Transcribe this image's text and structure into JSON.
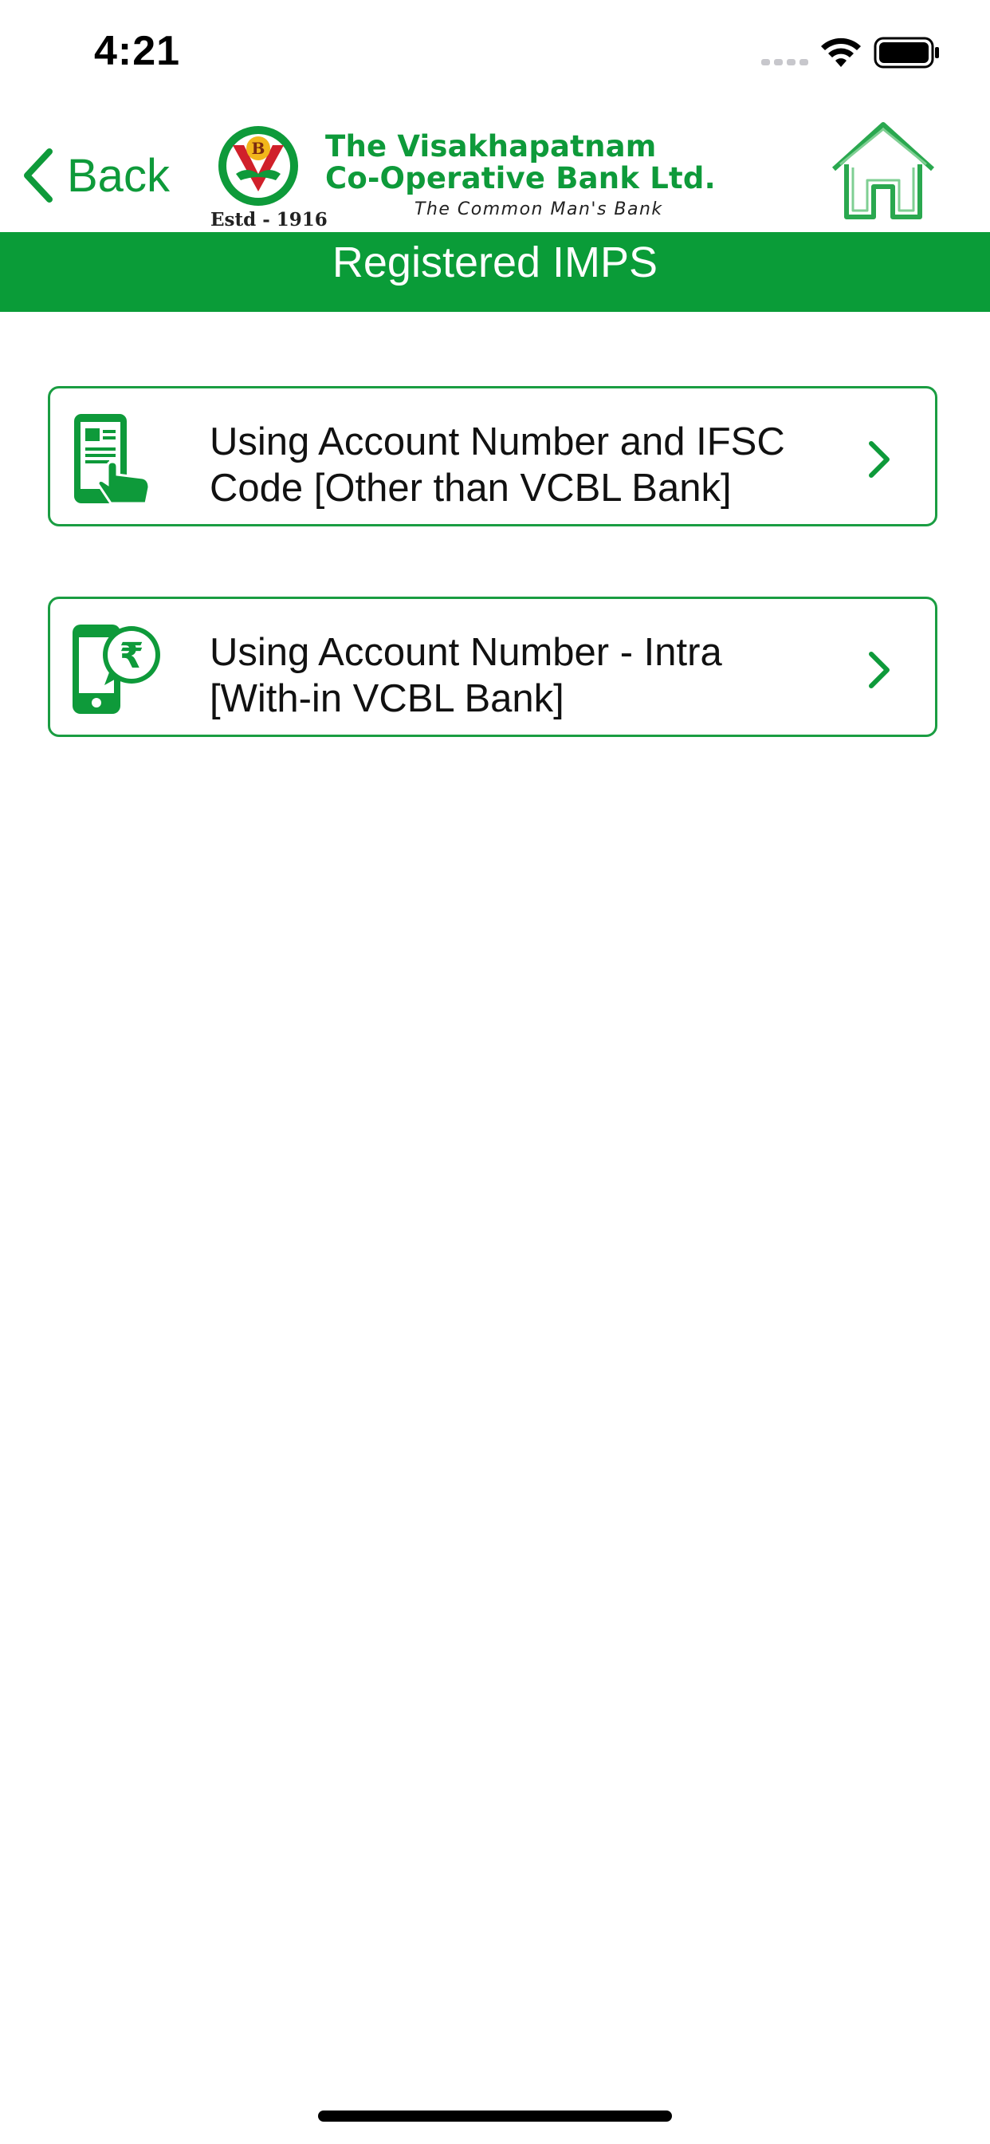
{
  "status_bar": {
    "time": "4:21",
    "signal_icon": "signal-dots-icon",
    "wifi_icon": "wifi-icon",
    "battery_icon": "battery-icon"
  },
  "nav_bar": {
    "back_label": "Back",
    "back_icon": "chevron-left-icon",
    "home_icon": "home-icon",
    "logo": {
      "name_line_1": "The Visakhapatnam",
      "name_line_2": "Co-Operative Bank Ltd.",
      "tagline": "The Common Man's Bank",
      "established": "Estd - 1916"
    }
  },
  "page": {
    "title": "Registered IMPS"
  },
  "options": [
    {
      "label": "Using Account Number and IFSC Code [Other than VCBL Bank]",
      "icon": "mobile-tap-icon"
    },
    {
      "label": "Using Account Number - Intra [With-in VCBL Bank]",
      "icon": "mobile-rupee-icon"
    }
  ],
  "colors": {
    "brand_green": "#0a9c38",
    "text": "#111111",
    "background": "#ffffff"
  }
}
